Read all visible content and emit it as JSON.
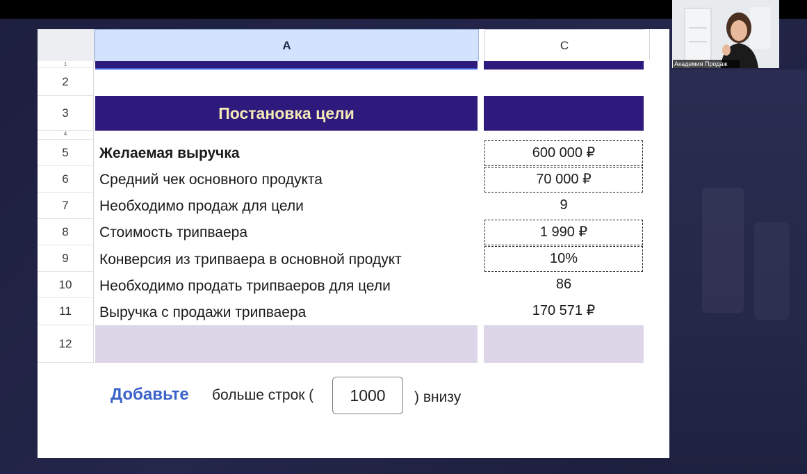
{
  "spreadsheet": {
    "column_headers": {
      "a": "A",
      "c": "C"
    },
    "title_row": {
      "row_number": "3",
      "text": "Постановка цели"
    },
    "rows": [
      {
        "num": "5",
        "label": "Желаемая выручка",
        "value": "600 000 ₽"
      },
      {
        "num": "6",
        "label": "Средний чек основного продукта",
        "value": "70 000 ₽"
      },
      {
        "num": "7",
        "label": "Необходимо продаж для цели",
        "value": "9"
      },
      {
        "num": "8",
        "label": "Стоимость трипваера",
        "value": "1 990 ₽"
      },
      {
        "num": "9",
        "label": "Конверсия из трипваера в основной продукт",
        "value": "10%"
      },
      {
        "num": "10",
        "label": "Необходимо продать трипваеров для цели",
        "value": "86"
      },
      {
        "num": "11",
        "label": "Выручка с продажи трипваера",
        "value": "170 571 ₽"
      }
    ],
    "row_numbers": {
      "r1": "1",
      "r2": "2",
      "r4": "4",
      "r12": "12"
    },
    "add_rows": {
      "link_label": "Добавьте",
      "text_before": "больше строк (",
      "count": "1000",
      "text_after": ") внизу"
    }
  },
  "video": {
    "participant_name": "Академия Продаж"
  },
  "colors": {
    "title_band": "#2e1a7d",
    "title_text": "#f5e9b8",
    "footer_band": "#dcd6e8",
    "header_selected": "#d3e3fd",
    "link": "#3b63c9"
  }
}
